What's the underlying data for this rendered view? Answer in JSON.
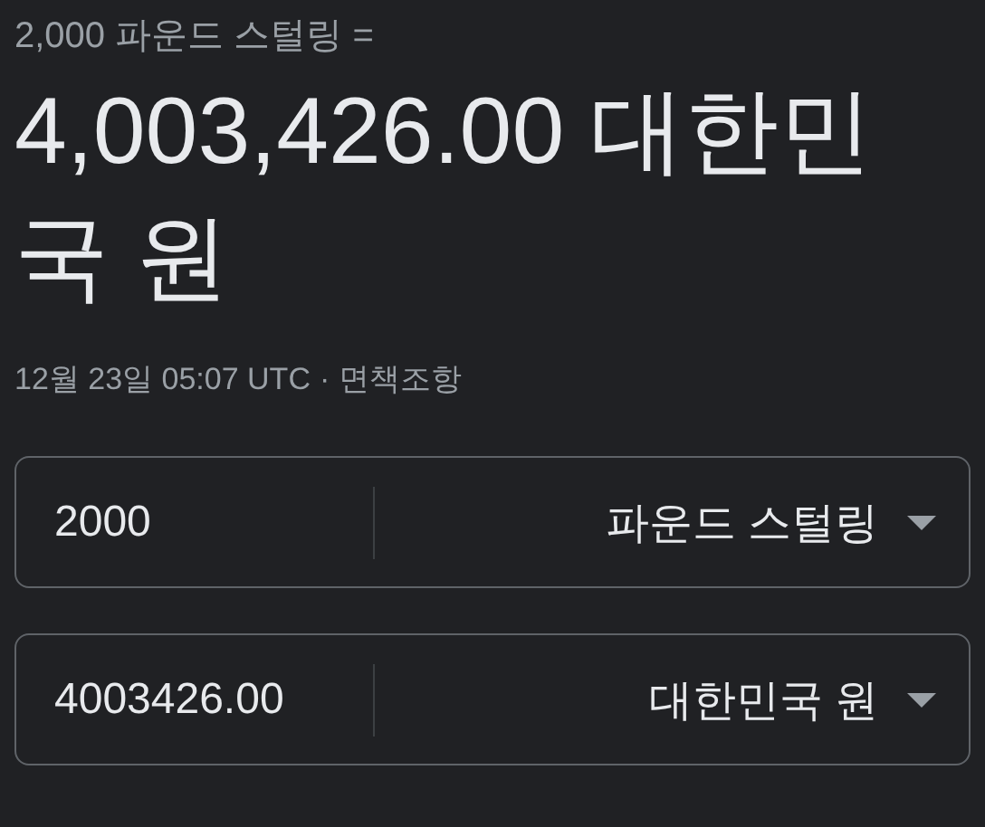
{
  "header": {
    "source": "2,000 파운드 스털링 =",
    "result": "4,003,426.00 대한민국 원"
  },
  "timestamp": {
    "text": "12월 23일 05:07 UTC",
    "separator": "·",
    "link": "면책조항"
  },
  "converters": [
    {
      "amount": "2000",
      "currency": "파운드 스털링"
    },
    {
      "amount": "4003426.00",
      "currency": "대한민국 원"
    }
  ]
}
